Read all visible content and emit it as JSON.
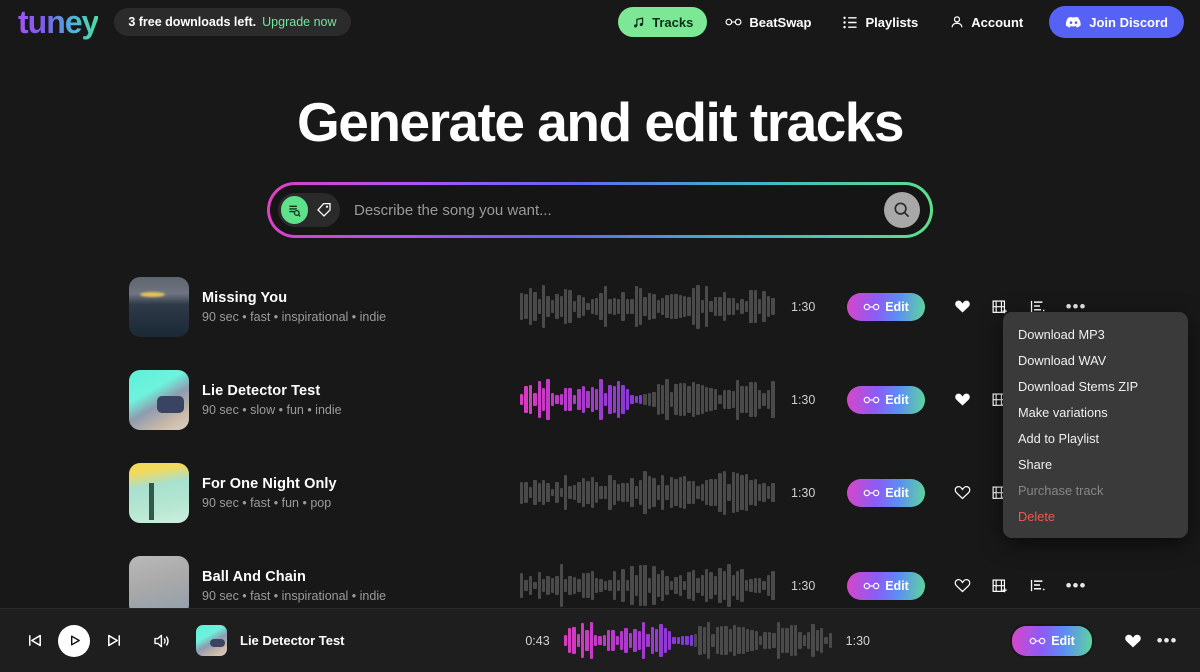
{
  "header": {
    "logo": "tuney",
    "promo_text": "3 free downloads left.",
    "promo_link": "Upgrade now",
    "nav": [
      {
        "label": "Tracks",
        "icon": "music-note-icon",
        "active": true
      },
      {
        "label": "BeatSwap",
        "icon": "beatswap-icon",
        "active": false
      },
      {
        "label": "Playlists",
        "icon": "playlist-icon",
        "active": false
      },
      {
        "label": "Account",
        "icon": "person-icon",
        "active": false
      }
    ],
    "discord_label": "Join Discord"
  },
  "hero": {
    "title": "Generate and edit tracks"
  },
  "search": {
    "placeholder": "Describe the song you want...",
    "value": "",
    "mode_icon": "text-prompt-icon",
    "tag_icon": "tag-icon",
    "submit_icon": "search-icon"
  },
  "tracks": [
    {
      "title": "Missing You",
      "subtitle": "90 sec • fast • inspirational • indie",
      "duration": "1:30",
      "edit_label": "Edit",
      "liked": true,
      "playing": false,
      "progress": 0,
      "art": "art-sea"
    },
    {
      "title": "Lie Detector Test",
      "subtitle": "90 sec • slow • fun • indie",
      "duration": "1:30",
      "edit_label": "Edit",
      "liked": true,
      "playing": true,
      "progress": 48,
      "art": "art-room"
    },
    {
      "title": "For One Night Only",
      "subtitle": "90 sec • fast • fun • pop",
      "duration": "1:30",
      "edit_label": "Edit",
      "liked": false,
      "playing": false,
      "progress": 0,
      "art": "art-palm"
    },
    {
      "title": "Ball And Chain",
      "subtitle": "90 sec • fast • inspirational • indie",
      "duration": "1:30",
      "edit_label": "Edit",
      "liked": false,
      "playing": false,
      "progress": 0,
      "art": "art-gray"
    }
  ],
  "context_menu": {
    "items": [
      {
        "label": "Download MP3",
        "state": "normal"
      },
      {
        "label": "Download WAV",
        "state": "normal"
      },
      {
        "label": "Download Stems ZIP",
        "state": "normal"
      },
      {
        "label": "Make variations",
        "state": "normal"
      },
      {
        "label": "Add to Playlist",
        "state": "normal"
      },
      {
        "label": "Share",
        "state": "normal"
      },
      {
        "label": "Purchase track",
        "state": "disabled"
      },
      {
        "label": "Delete",
        "state": "danger"
      }
    ]
  },
  "player": {
    "track_title": "Lie Detector Test",
    "elapsed": "0:43",
    "total": "1:30",
    "progress": 48,
    "edit_label": "Edit",
    "liked": true,
    "art": "art-room"
  },
  "colors": {
    "background": "#181818",
    "accent_green": "#7ce895",
    "discord_blue": "#5662f6",
    "edit_gradient_start": "#d946c8",
    "edit_gradient_end": "#5fd69a",
    "danger": "#f2554f",
    "wave_inactive": "#4a4a4a",
    "wave_active": "#b43ad0"
  }
}
